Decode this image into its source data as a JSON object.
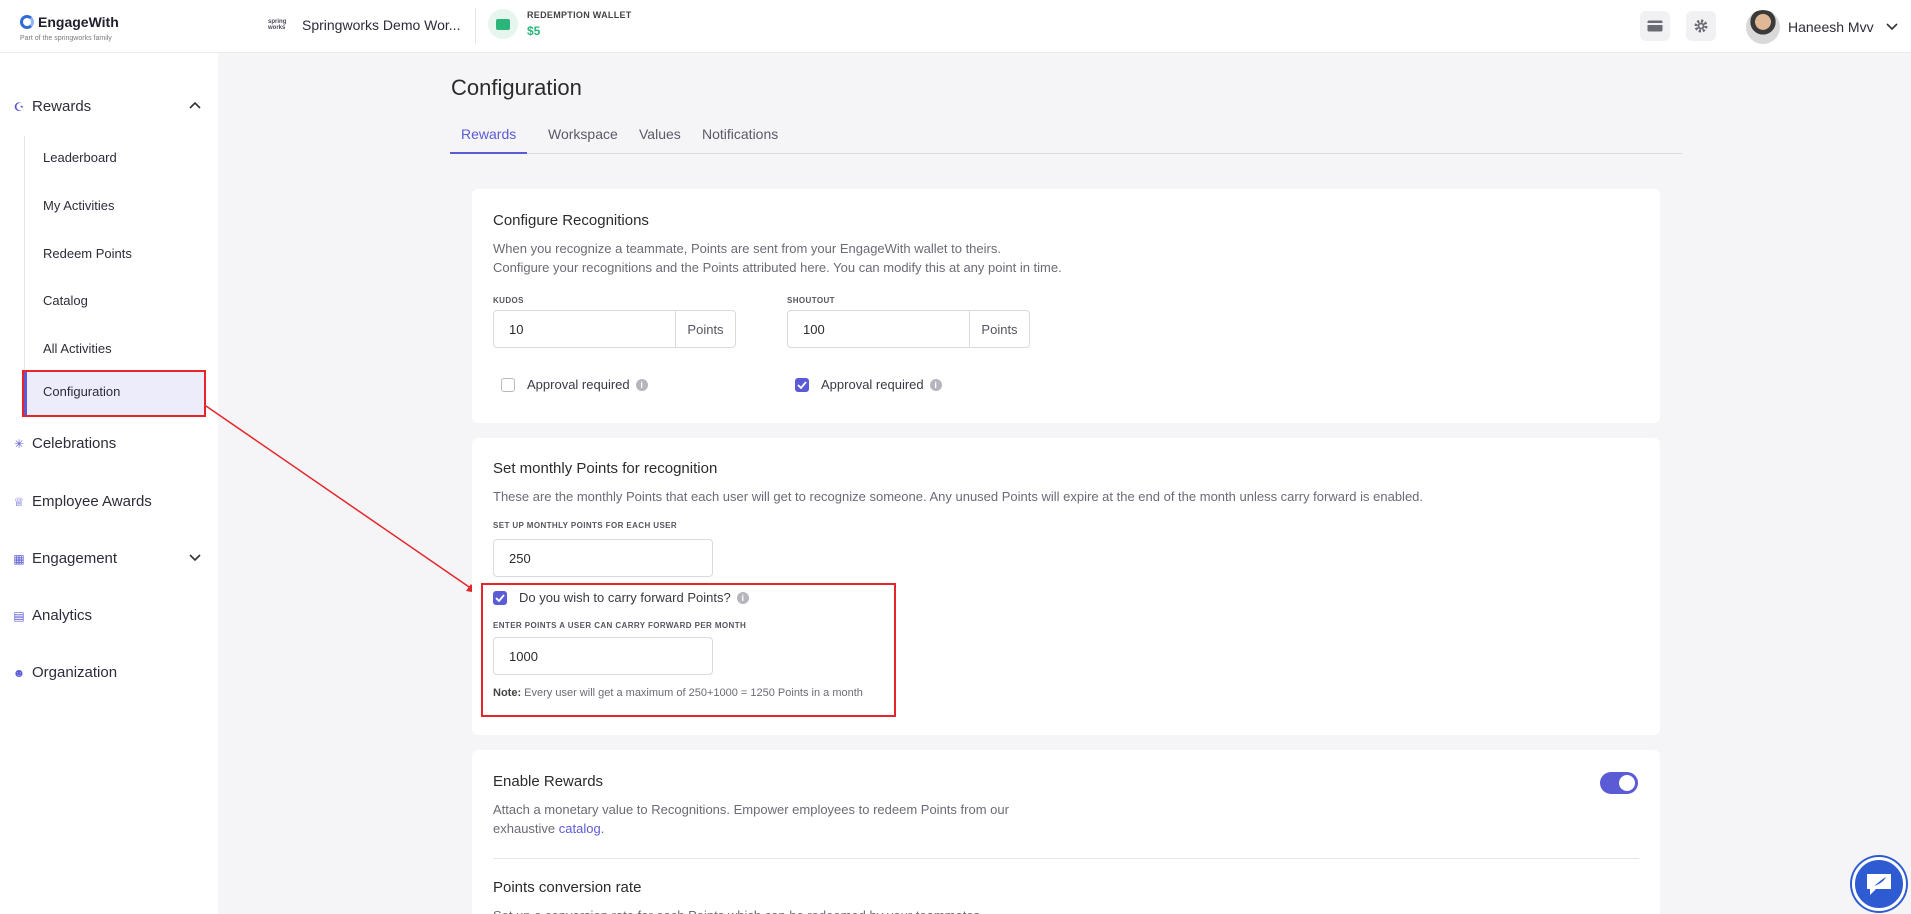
{
  "header": {
    "brand": "EngageWith",
    "brand_tagline": "Part of the springworks family",
    "workspace_logo_text": "spring works",
    "workspace_name": "Springworks Demo Wor...",
    "wallet_label": "REDEMPTION WALLET",
    "wallet_value": "$5",
    "user_name": "Haneesh Mvv"
  },
  "sidebar": {
    "rewards": "Rewards",
    "rewards_items": [
      "Leaderboard",
      "My Activities",
      "Redeem Points",
      "Catalog",
      "All Activities",
      "Configuration"
    ],
    "celebrations": "Celebrations",
    "employee_awards": "Employee Awards",
    "engagement": "Engagement",
    "analytics": "Analytics",
    "organization": "Organization"
  },
  "page": {
    "title": "Configuration",
    "tabs": [
      "Rewards",
      "Workspace",
      "Values",
      "Notifications"
    ]
  },
  "recognitions": {
    "title": "Configure Recognitions",
    "desc1": "When you recognize a teammate, Points are sent from your EngageWith wallet to theirs.",
    "desc2": "Configure your recognitions and the Points attributed here. You can modify this at any point in time.",
    "kudos_label": "KUDOS",
    "kudos_value": "10",
    "shoutout_label": "SHOUTOUT",
    "shoutout_value": "100",
    "suffix": "Points",
    "approval_label": "Approval required"
  },
  "monthly": {
    "title": "Set monthly Points for recognition",
    "desc": "These are the monthly Points that each user will get to recognize someone. Any unused Points will expire at the end of the month unless carry forward is enabled.",
    "setup_label": "SET UP MONTHLY POINTS FOR EACH USER",
    "setup_value": "250",
    "carry_label": "Do you wish to carry forward Points?",
    "carry_field_label": "ENTER POINTS A USER CAN CARRY FORWARD PER MONTH",
    "carry_value": "1000",
    "note_label": "Note:",
    "note_text": "Every user will get a maximum of 250+1000 = 1250 Points in a month"
  },
  "enable_rewards": {
    "title": "Enable Rewards",
    "desc1": "Attach a monetary value to Recognitions. Empower employees to redeem Points from our",
    "desc2_prefix": "exhaustive",
    "link": "catalog.",
    "conversion_title": "Points conversion rate",
    "conversion_desc": "Set up a conversion rate for each Points which can be redeemed by your teammates."
  },
  "colors": {
    "accent": "#5b5bd6",
    "highlight": "#e5252a",
    "wallet": "#2bb57a"
  }
}
